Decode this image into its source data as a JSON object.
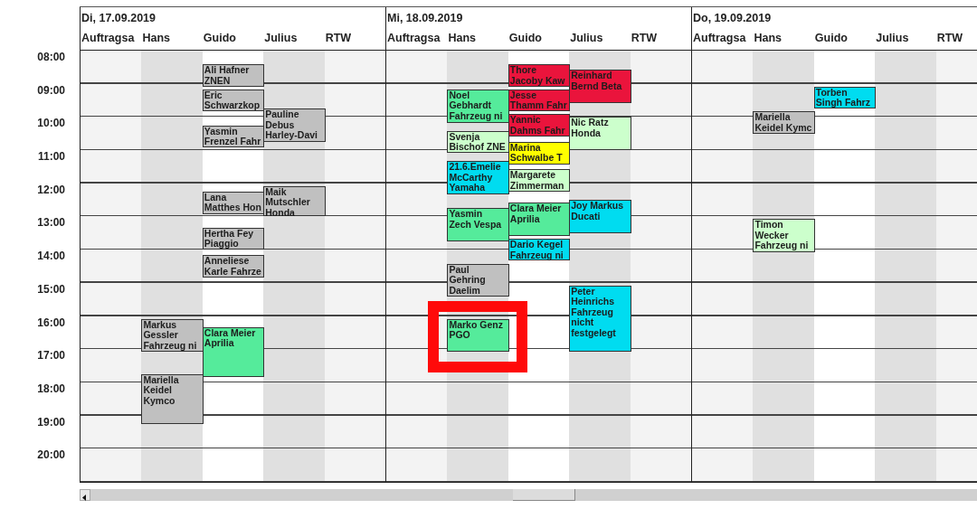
{
  "times": [
    "08:00",
    "09:00",
    "10:00",
    "11:00",
    "12:00",
    "13:00",
    "14:00",
    "15:00",
    "16:00",
    "17:00",
    "18:00",
    "19:00",
    "20:00"
  ],
  "days": [
    {
      "title": "Di, 17.09.2019",
      "columns": [
        {
          "name": "Auftragsa"
        },
        {
          "name": "Hans",
          "appointments": [
            {
              "lines": [
                "Markus",
                "Gessler",
                "Fahrzeug ni"
              ],
              "color": "#c0c0c0",
              "highlighted": false
            },
            {
              "lines": [
                "Mariella",
                "Keidel",
                "Kymco"
              ],
              "color": "#c0c0c0",
              "highlighted": false
            }
          ]
        },
        {
          "name": "Guido",
          "appointments": [
            {
              "lines": [
                "Ali Hafner",
                "ZNEN"
              ],
              "color": "#c0c0c0",
              "highlighted": false
            },
            {
              "lines": [
                "Eric",
                "Schwarzkop"
              ],
              "color": "#c0c0c0",
              "highlighted": false
            },
            {
              "lines": [
                "Yasmin",
                "Frenzel Fahr"
              ],
              "color": "#c0c0c0",
              "highlighted": false
            },
            {
              "lines": [
                "Lana",
                "Matthes Hon"
              ],
              "color": "#c0c0c0",
              "highlighted": false
            },
            {
              "lines": [
                "Hertha Fey",
                "Piaggio"
              ],
              "color": "#c0c0c0",
              "highlighted": false
            },
            {
              "lines": [
                "Anneliese",
                "Karle Fahrze"
              ],
              "color": "#c0c0c0",
              "highlighted": false
            },
            {
              "lines": [
                "Clara Meier",
                "Aprilia"
              ],
              "color": "#55eb9b",
              "highlighted": false
            }
          ]
        },
        {
          "name": "Julius",
          "appointments": [
            {
              "lines": [
                "Pauline",
                "Debus",
                "Harley-Davi"
              ],
              "color": "#c0c0c0",
              "highlighted": false
            },
            {
              "lines": [
                "Maik",
                "Mutschler",
                "Honda"
              ],
              "color": "#c0c0c0",
              "highlighted": false
            }
          ]
        },
        {
          "name": "RTW"
        }
      ]
    },
    {
      "title": "Mi, 18.09.2019",
      "columns": [
        {
          "name": "Auftragsa"
        },
        {
          "name": "Hans",
          "appointments": [
            {
              "lines": [
                "Noel",
                "Gebhardt",
                "Fahrzeug ni"
              ],
              "color": "#55eb9b",
              "highlighted": false
            },
            {
              "lines": [
                "Svenja",
                "Bischof ZNE"
              ],
              "color": "#ccffcc",
              "highlighted": false
            },
            {
              "lines": [
                "21.6.Emelie",
                "McCarthy",
                "Yamaha"
              ],
              "color": "#00dcf0",
              "highlighted": false
            },
            {
              "lines": [
                "Yasmin",
                "Zech Vespa"
              ],
              "color": "#55eb9b",
              "highlighted": false
            },
            {
              "lines": [
                "Paul",
                "Gehring",
                "Daelim"
              ],
              "color": "#c0c0c0",
              "highlighted": false
            },
            {
              "lines": [
                "Marko Genz",
                "PGO"
              ],
              "color": "#55eb9b",
              "highlighted": true
            }
          ]
        },
        {
          "name": "Guido",
          "appointments": [
            {
              "lines": [
                "Thore",
                "Jacoby Kaw"
              ],
              "color": "#ea143c",
              "highlighted": false
            },
            {
              "lines": [
                "Jesse",
                "Thamm Fahr"
              ],
              "color": "#ea143c",
              "highlighted": false
            },
            {
              "lines": [
                "Yannic",
                "Dahms Fahr"
              ],
              "color": "#ea143c",
              "highlighted": false
            },
            {
              "lines": [
                "Marina",
                "Schwalbe T"
              ],
              "color": "#ffff00",
              "highlighted": false
            },
            {
              "lines": [
                "Margarete",
                "Zimmerman"
              ],
              "color": "#ccffcc",
              "highlighted": false
            },
            {
              "lines": [
                "Clara Meier",
                "Aprilia"
              ],
              "color": "#55eb9b",
              "highlighted": false
            },
            {
              "lines": [
                "Dario Kegel",
                "Fahrzeug ni"
              ],
              "color": "#00dcf0",
              "highlighted": false
            }
          ]
        },
        {
          "name": "Julius",
          "appointments": [
            {
              "lines": [
                "Reinhard",
                "Bernd Beta"
              ],
              "color": "#ea143c",
              "highlighted": false
            },
            {
              "lines": [
                "Nic Ratz",
                "Honda"
              ],
              "color": "#ccffcc",
              "highlighted": false
            },
            {
              "lines": [
                "Joy Markus",
                "Ducati"
              ],
              "color": "#00dcf0",
              "highlighted": false
            },
            {
              "lines": [
                "Peter",
                "Heinrichs",
                "Fahrzeug",
                "nicht",
                "festgelegt"
              ],
              "color": "#00dcf0",
              "highlighted": false
            }
          ]
        },
        {
          "name": "RTW"
        }
      ]
    },
    {
      "title": "Do, 19.09.2019",
      "columns": [
        {
          "name": "Auftragsa"
        },
        {
          "name": "Hans",
          "appointments": [
            {
              "lines": [
                "Mariella",
                "Keidel Kymc"
              ],
              "color": "#c0c0c0",
              "highlighted": false
            },
            {
              "lines": [
                "Timon",
                "Wecker",
                "Fahrzeug ni"
              ],
              "color": "#ccffcc",
              "highlighted": false
            }
          ]
        },
        {
          "name": "Guido",
          "appointments": [
            {
              "lines": [
                "Torben",
                "Singh Fahrz"
              ],
              "color": "#00dcf0",
              "highlighted": false
            }
          ]
        },
        {
          "name": "Julius"
        },
        {
          "name": "RTW"
        }
      ]
    }
  ]
}
